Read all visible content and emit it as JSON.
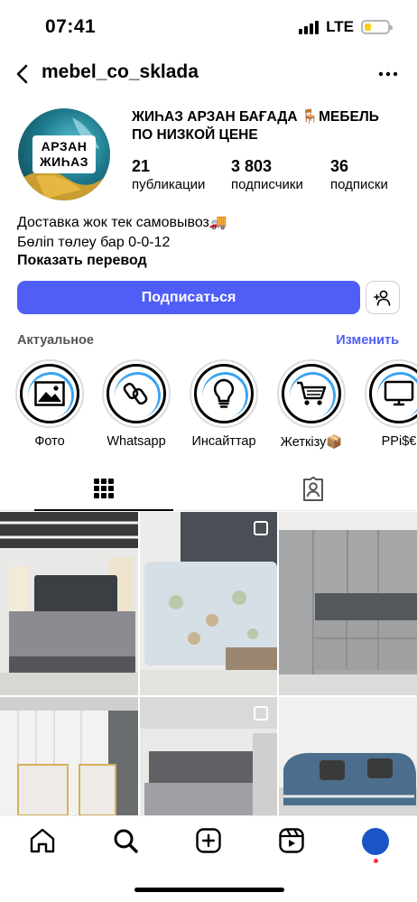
{
  "status_bar": {
    "time": "07:41",
    "network": "LTE",
    "battery_percent": 30
  },
  "header": {
    "username": "mebel_co_sklada",
    "back_icon": "chevron-left-icon",
    "more_icon": "more-horizontal-icon"
  },
  "profile": {
    "avatar_text_line1": "АРЗАН",
    "avatar_text_line2": "ЖИҺАЗ",
    "full_name": "ЖИҺАЗ АРЗАН БАҒАДА 🪑МЕБЕЛЬ ПО НИЗКОЙ ЦЕНЕ",
    "stats": [
      {
        "value": "21",
        "label": "публикации"
      },
      {
        "value": "3 803",
        "label": "подписчики"
      },
      {
        "value": "36",
        "label": "подписки"
      }
    ],
    "bio_line1": "Доставка жок тек самовывоз🚚",
    "bio_line2": "Бөліп төлеу бар 0-0-12",
    "translate_label": "Показать перевод"
  },
  "actions": {
    "follow_label": "Подписаться",
    "add_user_icon": "add-user-icon"
  },
  "highlights": {
    "title": "Актуальное",
    "edit_label": "Изменить",
    "items": [
      {
        "label": "Фото",
        "icon": "photo-icon"
      },
      {
        "label": "Whatsapp",
        "icon": "whatsapp-icon"
      },
      {
        "label": "Инсайттар",
        "icon": "lightbulb-icon"
      },
      {
        "label": "Жеткізу📦",
        "icon": "cart-icon"
      },
      {
        "label": "PPi$€",
        "icon": "monitor-icon"
      }
    ]
  },
  "tabs": [
    {
      "name": "grid",
      "icon": "grid-icon",
      "active": true
    },
    {
      "name": "tagged",
      "icon": "tagged-person-icon",
      "active": false
    }
  ],
  "posts": [
    {
      "subject": "bed with grey headboard in showroom",
      "multi": false
    },
    {
      "subject": "bed with floral bedding",
      "multi": true
    },
    {
      "subject": "grey kitchen cabinets",
      "multi": false
    },
    {
      "subject": "bed with tufted headboard and curtains",
      "multi": false
    },
    {
      "subject": "grey upholstered bed",
      "multi": true
    },
    {
      "subject": "blue sofa set",
      "multi": false
    }
  ],
  "bottom_nav": [
    {
      "name": "home",
      "icon": "home-icon"
    },
    {
      "name": "search",
      "icon": "search-icon"
    },
    {
      "name": "create",
      "icon": "plus-square-icon"
    },
    {
      "name": "reels",
      "icon": "reels-icon"
    },
    {
      "name": "profile",
      "icon": "profile-avatar-icon"
    }
  ],
  "colors": {
    "accent": "#4f5ef7",
    "battery": "#f5d01f",
    "story_arc": "#3aa4f0"
  }
}
